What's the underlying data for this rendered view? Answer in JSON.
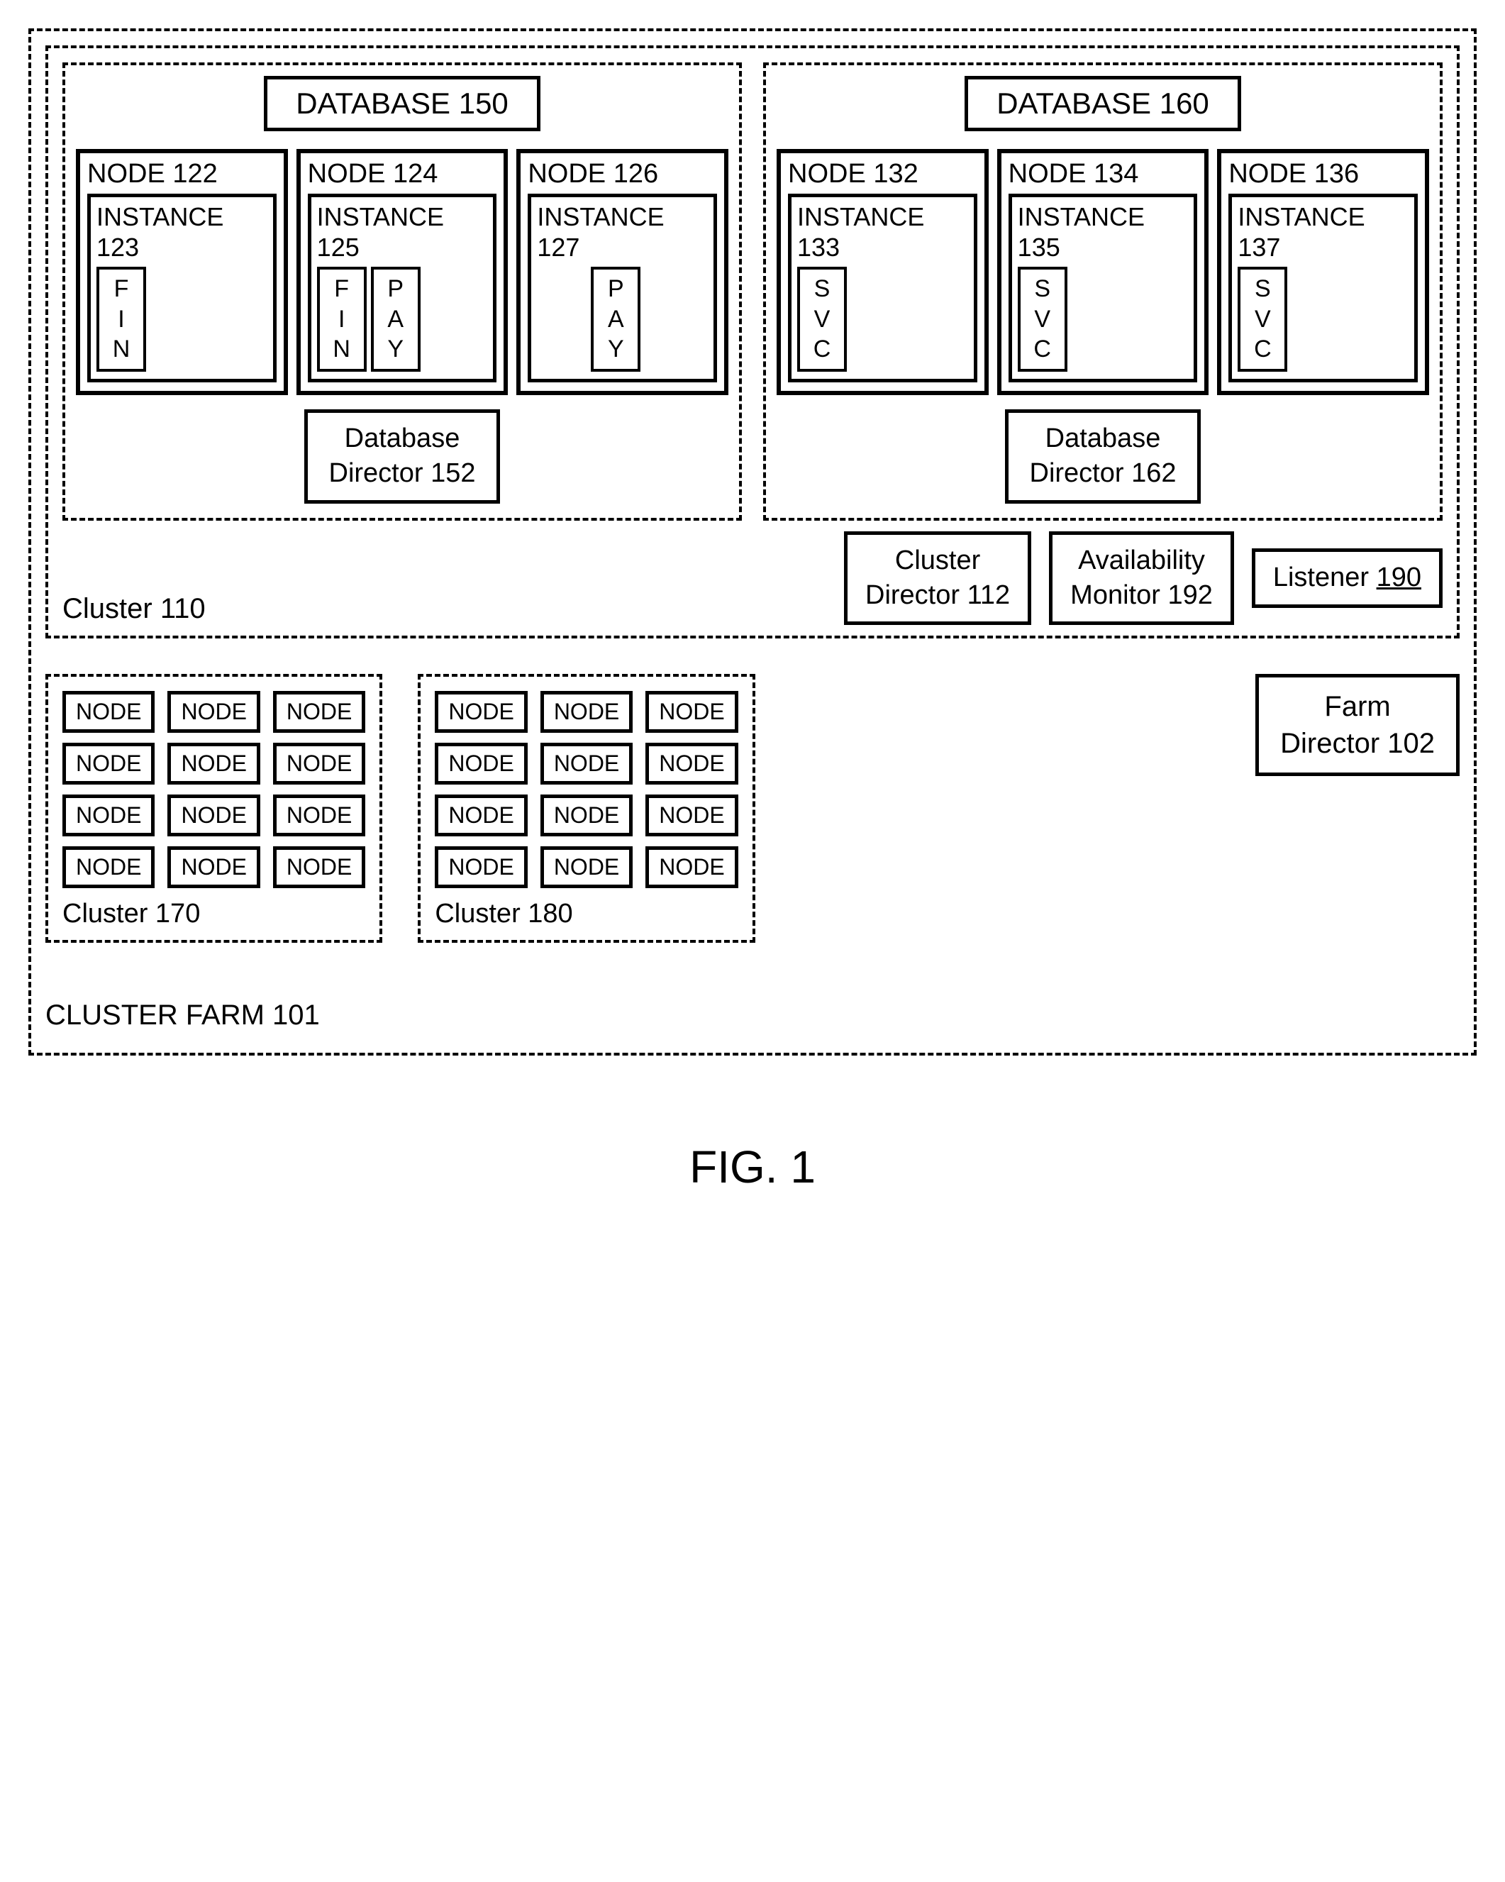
{
  "farm": {
    "label": "CLUSTER FARM 101"
  },
  "cluster110": {
    "label": "Cluster 110",
    "db150": {
      "title": "DATABASE  150",
      "node122": {
        "title": "NODE 122",
        "instance": "INSTANCE 123",
        "svc1": {
          "a": "F",
          "b": "I",
          "c": "N"
        }
      },
      "node124": {
        "title": "NODE 124",
        "instance": "INSTANCE 125",
        "svc1": {
          "a": "F",
          "b": "I",
          "c": "N"
        },
        "svc2": {
          "a": "P",
          "b": "A",
          "c": "Y"
        }
      },
      "node126": {
        "title": "NODE 126",
        "instance": "INSTANCE 127",
        "svc2": {
          "a": "P",
          "b": "A",
          "c": "Y"
        }
      },
      "director": {
        "l1": "Database",
        "l2": "Director 152"
      }
    },
    "db160": {
      "title": "DATABASE  160",
      "node132": {
        "title": "NODE 132",
        "instance": "INSTANCE 133",
        "svc": {
          "a": "S",
          "b": "V",
          "c": "C"
        }
      },
      "node134": {
        "title": "NODE 134",
        "instance": "INSTANCE 135",
        "svc": {
          "a": "S",
          "b": "V",
          "c": "C"
        }
      },
      "node136": {
        "title": "NODE 136",
        "instance": "INSTANCE 137",
        "svc": {
          "a": "S",
          "b": "V",
          "c": "C"
        }
      },
      "director": {
        "l1": "Database",
        "l2": "Director 162"
      }
    },
    "clusterDirector": {
      "l1": "Cluster",
      "l2": "Director 112"
    },
    "availability": {
      "l1": "Availability",
      "l2": "Monitor 192"
    },
    "listener": {
      "text": "Listener ",
      "num": "190"
    }
  },
  "cluster170": {
    "label": "Cluster 170",
    "node": "NODE"
  },
  "cluster180": {
    "label": "Cluster 180",
    "node": "NODE"
  },
  "farmDirector": {
    "l1": "Farm",
    "l2": "Director 102"
  },
  "figure": "FIG. 1"
}
